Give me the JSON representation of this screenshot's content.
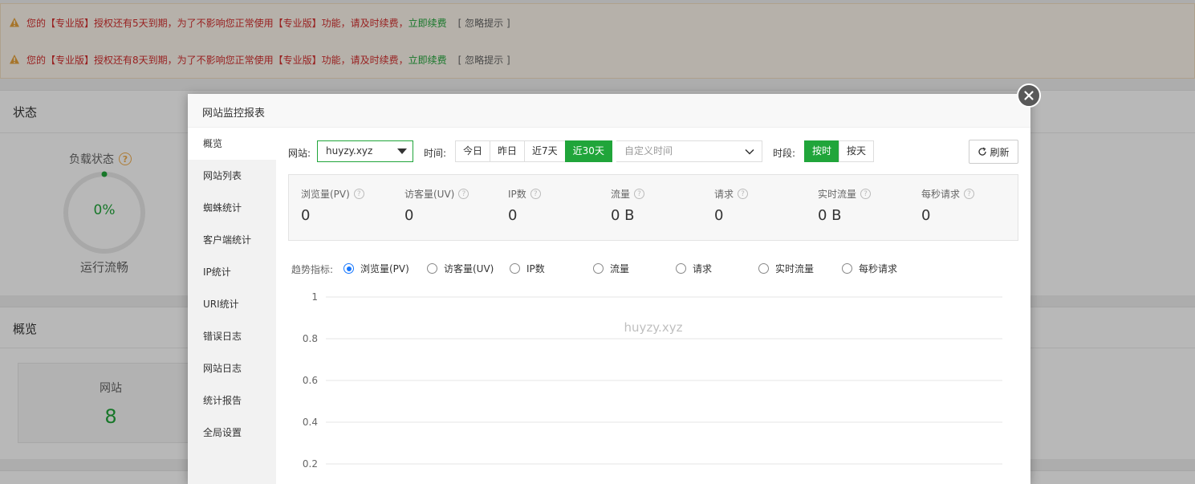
{
  "notices": [
    {
      "text": "您的【专业版】授权还有5天到期，为了不影响您正常使用【专业版】功能，请及时续费，",
      "renew": "立即续费",
      "ignore": "[ 忽略提示 ]"
    },
    {
      "text": "您的【专业版】授权还有8天到期，为了不影响您正常使用【专业版】功能，请及时续费，",
      "renew": "立即续费",
      "ignore": "[ 忽略提示 ]"
    }
  ],
  "status_panel": {
    "title": "状态",
    "gauge_label": "负载状态",
    "gauge_value": "0%",
    "gauge_status": "运行流畅",
    "gauge_fraction": 0
  },
  "overview_panel": {
    "title": "概览",
    "site_label": "网站",
    "site_count": "8"
  },
  "modal": {
    "title": "网站监控报表",
    "nav": [
      "概览",
      "网站列表",
      "蜘蛛统计",
      "客户端统计",
      "IP统计",
      "URI统计",
      "错误日志",
      "网站日志",
      "统计报告",
      "全局设置"
    ],
    "active_nav": 0,
    "filters": {
      "site_label": "网站:",
      "site_value": "huyzy.xyz",
      "time_label": "时间:",
      "time_buttons": [
        "今日",
        "昨日",
        "近7天",
        "近30天"
      ],
      "active_time": 3,
      "custom_time_placeholder": "自定义时间",
      "period_label": "时段:",
      "period_buttons": [
        "按时",
        "按天"
      ],
      "active_period": 0,
      "refresh_label": "刷新"
    },
    "stats": [
      {
        "label": "浏览量(PV)",
        "value": "0"
      },
      {
        "label": "访客量(UV)",
        "value": "0"
      },
      {
        "label": "IP数",
        "value": "0"
      },
      {
        "label": "流量",
        "value": "0 B"
      },
      {
        "label": "请求",
        "value": "0"
      },
      {
        "label": "实时流量",
        "value": "0 B"
      },
      {
        "label": "每秒请求",
        "value": "0"
      }
    ],
    "trend": {
      "label": "趋势指标:",
      "options": [
        "浏览量(PV)",
        "访客量(UV)",
        "IP数",
        "流量",
        "请求",
        "实时流量",
        "每秒请求"
      ],
      "selected": 0
    }
  },
  "chart_data": {
    "type": "line",
    "title": "huyzy.xyz",
    "y_ticks": [
      "1",
      "0.8",
      "0.6",
      "0.4",
      "0.2"
    ],
    "ylim": [
      0,
      1
    ],
    "grid": true,
    "series": []
  },
  "colors": {
    "accent": "#20a53a",
    "warning": "#d32f2f",
    "radio": "#1677ff"
  }
}
